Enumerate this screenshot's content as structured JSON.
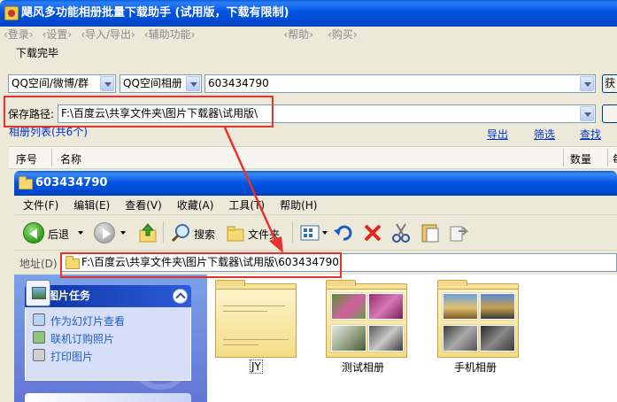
{
  "app": {
    "title": "飓风多功能相册批量下载助手 (试用版，下载有限制)",
    "menu": [
      "‹登录›",
      "‹设置›",
      "‹导入/导出›",
      "‹辅助功能›"
    ],
    "menu_right": [
      "‹帮助›",
      "‹购买›"
    ],
    "status": "下载完毕",
    "source_select": "QQ空间/微博/群",
    "album_select": "QQ空间相册",
    "account_value": "603434790",
    "get_button_label": "获",
    "save_path_label": "保存路径:",
    "save_path_value": "F:\\百度云\\共享文件夹\\图片下载器\\试用版\\",
    "list_title": "相册列表(共6个)",
    "links": {
      "export": "导出",
      "filter": "筛选",
      "find": "查找"
    },
    "table_columns": {
      "index": "序号",
      "name": "名称",
      "count": "数量",
      "extra": "每"
    }
  },
  "explorer": {
    "title": "603434790",
    "menu": [
      "文件(F)",
      "编辑(E)",
      "查看(V)",
      "收藏(A)",
      "工具(T)",
      "帮助(H)"
    ],
    "toolbar": {
      "back": "后退",
      "search": "搜索",
      "folders": "文件夹"
    },
    "address_label": "地址(D)",
    "address_value": "F:\\百度云\\共享文件夹\\图片下载器\\试用版\\603434790",
    "tasks_title": "图片任务",
    "tasks": [
      "作为幻灯片查看",
      "联机订购照片",
      "打印图片"
    ],
    "folders": [
      {
        "name": "JY"
      },
      {
        "name": "测试相册"
      },
      {
        "name": "手机相册"
      }
    ]
  },
  "colors": {
    "highlight_red": "#e8322e",
    "xp_blue": "#0054e3",
    "link_blue": "#0033cc"
  }
}
